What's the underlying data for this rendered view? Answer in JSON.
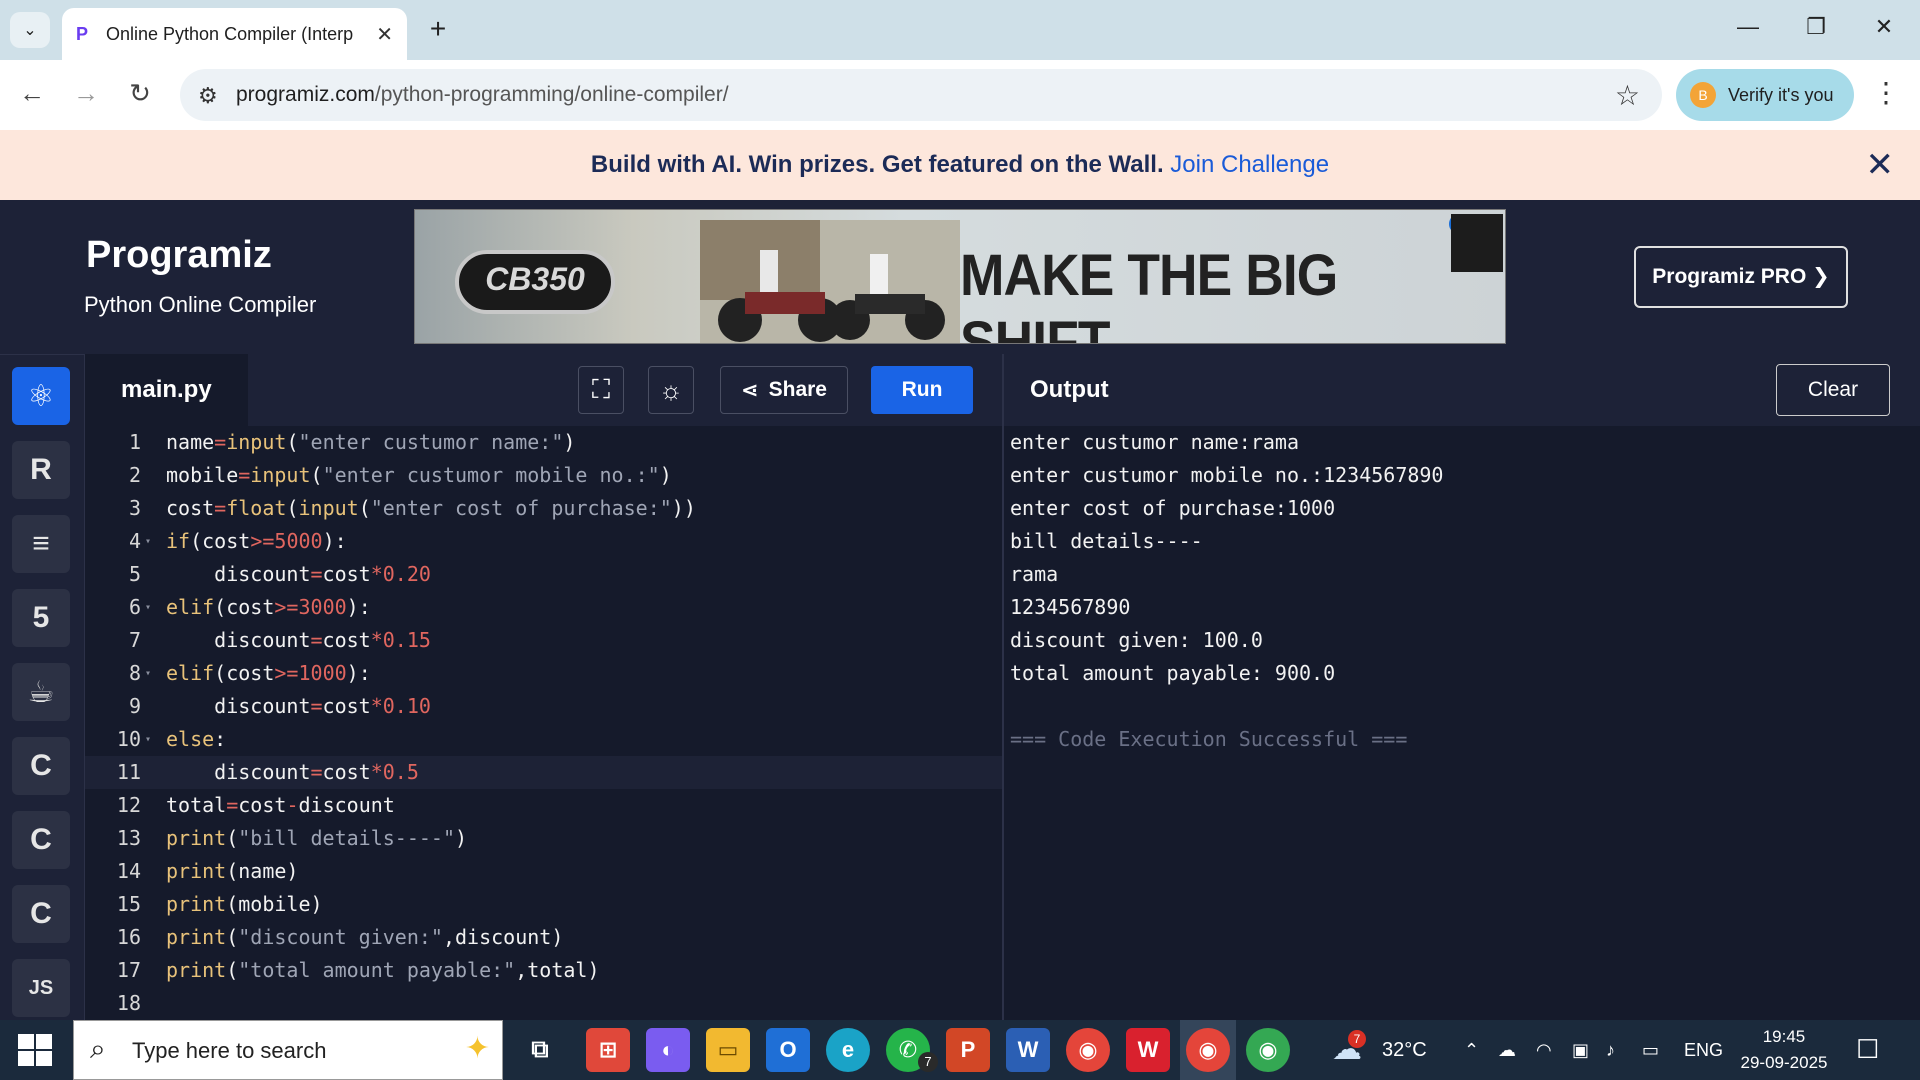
{
  "browser": {
    "tab_title": "Online Python Compiler (Interp",
    "tab_close": "✕",
    "new_tab": "+",
    "url_host": "programiz.com",
    "url_path": "/python-programming/online-compiler/",
    "profile_initial": "B",
    "profile_label": "Verify it's you"
  },
  "promo": {
    "text": "Build with AI. Win prizes. Get featured on the Wall.",
    "link": "Join Challenge",
    "close": "✕"
  },
  "header": {
    "logo": "Programiz",
    "subtitle": "Python Online Compiler",
    "ad_headline": "MAKE THE BIG SHIFT",
    "ad_badge": "CB350",
    "pro_button": "Programiz PRO ❯"
  },
  "sidebar": {
    "items": [
      {
        "name": "python-icon",
        "glyph": "🐍"
      },
      {
        "name": "r-icon",
        "glyph": "R"
      },
      {
        "name": "sql-icon",
        "glyph": "🛢"
      },
      {
        "name": "html-icon",
        "glyph": "5"
      },
      {
        "name": "java-icon",
        "glyph": "☕"
      },
      {
        "name": "c-icon",
        "glyph": "C"
      },
      {
        "name": "cpp-icon",
        "glyph": "C"
      },
      {
        "name": "csharp-icon",
        "glyph": "C"
      },
      {
        "name": "js-icon",
        "glyph": "JS"
      }
    ]
  },
  "editor": {
    "file_name": "main.py",
    "share_label": "Share",
    "run_label": "Run",
    "lines": [
      "name=input(\"enter custumor name:\")",
      "mobile=input(\"enter custumor mobile no.:\")",
      "cost=float(input(\"enter cost of purchase:\"))",
      "if(cost>=5000):",
      "    discount=cost*0.20",
      "elif(cost>=3000):",
      "    discount=cost*0.15",
      "elif(cost>=1000):",
      "    discount=cost*0.10",
      "else:",
      "    discount=cost*0.5",
      "total=cost-discount",
      "print(\"bill details----\")",
      "print(name)",
      "print(mobile)",
      "print(\"discount given:\",discount)",
      "print(\"total amount payable:\",total)",
      ""
    ]
  },
  "output": {
    "title": "Output",
    "clear_label": "Clear",
    "lines": [
      "enter custumor name:rama",
      "enter custumor mobile no.:1234567890",
      "enter cost of purchase:1000",
      "bill details----",
      "rama",
      "1234567890",
      "discount given: 100.0",
      "total amount payable: 900.0",
      "",
      "=== Code Execution Successful ==="
    ]
  },
  "taskbar": {
    "search_placeholder": "Type here to search",
    "weather_badge": "7",
    "temperature": "32°C",
    "whatsapp_badge": "7",
    "language": "ENG",
    "time": "19:45",
    "date": "29-09-2025"
  }
}
